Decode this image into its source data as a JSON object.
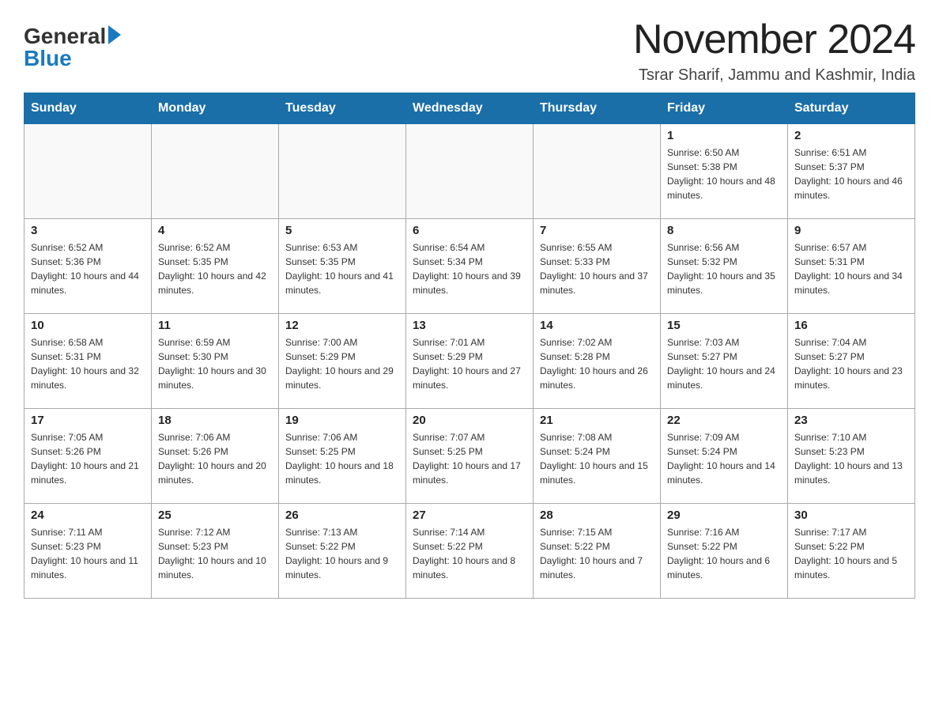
{
  "header": {
    "logo_general": "General",
    "logo_blue": "Blue",
    "month_title": "November 2024",
    "location": "Tsrar Sharif, Jammu and Kashmir, India"
  },
  "days_of_week": [
    "Sunday",
    "Monday",
    "Tuesday",
    "Wednesday",
    "Thursday",
    "Friday",
    "Saturday"
  ],
  "weeks": [
    [
      {
        "day": "",
        "sunrise": "",
        "sunset": "",
        "daylight": ""
      },
      {
        "day": "",
        "sunrise": "",
        "sunset": "",
        "daylight": ""
      },
      {
        "day": "",
        "sunrise": "",
        "sunset": "",
        "daylight": ""
      },
      {
        "day": "",
        "sunrise": "",
        "sunset": "",
        "daylight": ""
      },
      {
        "day": "",
        "sunrise": "",
        "sunset": "",
        "daylight": ""
      },
      {
        "day": "1",
        "sunrise": "Sunrise: 6:50 AM",
        "sunset": "Sunset: 5:38 PM",
        "daylight": "Daylight: 10 hours and 48 minutes."
      },
      {
        "day": "2",
        "sunrise": "Sunrise: 6:51 AM",
        "sunset": "Sunset: 5:37 PM",
        "daylight": "Daylight: 10 hours and 46 minutes."
      }
    ],
    [
      {
        "day": "3",
        "sunrise": "Sunrise: 6:52 AM",
        "sunset": "Sunset: 5:36 PM",
        "daylight": "Daylight: 10 hours and 44 minutes."
      },
      {
        "day": "4",
        "sunrise": "Sunrise: 6:52 AM",
        "sunset": "Sunset: 5:35 PM",
        "daylight": "Daylight: 10 hours and 42 minutes."
      },
      {
        "day": "5",
        "sunrise": "Sunrise: 6:53 AM",
        "sunset": "Sunset: 5:35 PM",
        "daylight": "Daylight: 10 hours and 41 minutes."
      },
      {
        "day": "6",
        "sunrise": "Sunrise: 6:54 AM",
        "sunset": "Sunset: 5:34 PM",
        "daylight": "Daylight: 10 hours and 39 minutes."
      },
      {
        "day": "7",
        "sunrise": "Sunrise: 6:55 AM",
        "sunset": "Sunset: 5:33 PM",
        "daylight": "Daylight: 10 hours and 37 minutes."
      },
      {
        "day": "8",
        "sunrise": "Sunrise: 6:56 AM",
        "sunset": "Sunset: 5:32 PM",
        "daylight": "Daylight: 10 hours and 35 minutes."
      },
      {
        "day": "9",
        "sunrise": "Sunrise: 6:57 AM",
        "sunset": "Sunset: 5:31 PM",
        "daylight": "Daylight: 10 hours and 34 minutes."
      }
    ],
    [
      {
        "day": "10",
        "sunrise": "Sunrise: 6:58 AM",
        "sunset": "Sunset: 5:31 PM",
        "daylight": "Daylight: 10 hours and 32 minutes."
      },
      {
        "day": "11",
        "sunrise": "Sunrise: 6:59 AM",
        "sunset": "Sunset: 5:30 PM",
        "daylight": "Daylight: 10 hours and 30 minutes."
      },
      {
        "day": "12",
        "sunrise": "Sunrise: 7:00 AM",
        "sunset": "Sunset: 5:29 PM",
        "daylight": "Daylight: 10 hours and 29 minutes."
      },
      {
        "day": "13",
        "sunrise": "Sunrise: 7:01 AM",
        "sunset": "Sunset: 5:29 PM",
        "daylight": "Daylight: 10 hours and 27 minutes."
      },
      {
        "day": "14",
        "sunrise": "Sunrise: 7:02 AM",
        "sunset": "Sunset: 5:28 PM",
        "daylight": "Daylight: 10 hours and 26 minutes."
      },
      {
        "day": "15",
        "sunrise": "Sunrise: 7:03 AM",
        "sunset": "Sunset: 5:27 PM",
        "daylight": "Daylight: 10 hours and 24 minutes."
      },
      {
        "day": "16",
        "sunrise": "Sunrise: 7:04 AM",
        "sunset": "Sunset: 5:27 PM",
        "daylight": "Daylight: 10 hours and 23 minutes."
      }
    ],
    [
      {
        "day": "17",
        "sunrise": "Sunrise: 7:05 AM",
        "sunset": "Sunset: 5:26 PM",
        "daylight": "Daylight: 10 hours and 21 minutes."
      },
      {
        "day": "18",
        "sunrise": "Sunrise: 7:06 AM",
        "sunset": "Sunset: 5:26 PM",
        "daylight": "Daylight: 10 hours and 20 minutes."
      },
      {
        "day": "19",
        "sunrise": "Sunrise: 7:06 AM",
        "sunset": "Sunset: 5:25 PM",
        "daylight": "Daylight: 10 hours and 18 minutes."
      },
      {
        "day": "20",
        "sunrise": "Sunrise: 7:07 AM",
        "sunset": "Sunset: 5:25 PM",
        "daylight": "Daylight: 10 hours and 17 minutes."
      },
      {
        "day": "21",
        "sunrise": "Sunrise: 7:08 AM",
        "sunset": "Sunset: 5:24 PM",
        "daylight": "Daylight: 10 hours and 15 minutes."
      },
      {
        "day": "22",
        "sunrise": "Sunrise: 7:09 AM",
        "sunset": "Sunset: 5:24 PM",
        "daylight": "Daylight: 10 hours and 14 minutes."
      },
      {
        "day": "23",
        "sunrise": "Sunrise: 7:10 AM",
        "sunset": "Sunset: 5:23 PM",
        "daylight": "Daylight: 10 hours and 13 minutes."
      }
    ],
    [
      {
        "day": "24",
        "sunrise": "Sunrise: 7:11 AM",
        "sunset": "Sunset: 5:23 PM",
        "daylight": "Daylight: 10 hours and 11 minutes."
      },
      {
        "day": "25",
        "sunrise": "Sunrise: 7:12 AM",
        "sunset": "Sunset: 5:23 PM",
        "daylight": "Daylight: 10 hours and 10 minutes."
      },
      {
        "day": "26",
        "sunrise": "Sunrise: 7:13 AM",
        "sunset": "Sunset: 5:22 PM",
        "daylight": "Daylight: 10 hours and 9 minutes."
      },
      {
        "day": "27",
        "sunrise": "Sunrise: 7:14 AM",
        "sunset": "Sunset: 5:22 PM",
        "daylight": "Daylight: 10 hours and 8 minutes."
      },
      {
        "day": "28",
        "sunrise": "Sunrise: 7:15 AM",
        "sunset": "Sunset: 5:22 PM",
        "daylight": "Daylight: 10 hours and 7 minutes."
      },
      {
        "day": "29",
        "sunrise": "Sunrise: 7:16 AM",
        "sunset": "Sunset: 5:22 PM",
        "daylight": "Daylight: 10 hours and 6 minutes."
      },
      {
        "day": "30",
        "sunrise": "Sunrise: 7:17 AM",
        "sunset": "Sunset: 5:22 PM",
        "daylight": "Daylight: 10 hours and 5 minutes."
      }
    ]
  ]
}
